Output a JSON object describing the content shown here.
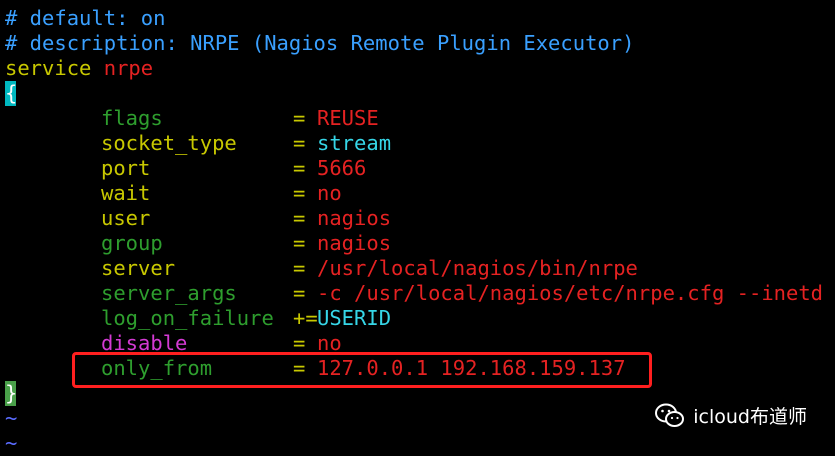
{
  "colors": {
    "comment": "#3aa0ff",
    "keyword": "#c8c800",
    "string": "#e52222",
    "operator": "#c8c800",
    "cyan": "#36d6e7",
    "green_dim": "#2e9e2e",
    "magenta": "#d43ad4",
    "brace_cursor": "#00b8c0",
    "highlight_box": "#ff1f1f"
  },
  "header": {
    "comment1": "# default: on",
    "comment2_prefix": "# description: ",
    "comment2_text": "NRPE (Nagios Remote Plugin Executor)",
    "service_keyword": "service",
    "service_name": "nrpe",
    "open_brace": "{",
    "close_brace": "}"
  },
  "config": [
    {
      "key": "flags",
      "op": "=",
      "value": "REUSE",
      "key_color": "#2e9e2e",
      "value_color": "#e52222"
    },
    {
      "key": "socket_type",
      "op": "=",
      "value": "stream",
      "key_color": "#c8c800",
      "value_color": "#36d6e7"
    },
    {
      "key": "port",
      "op": "=",
      "value": "5666",
      "key_color": "#c8c800",
      "value_color": "#e52222"
    },
    {
      "key": "wait",
      "op": "=",
      "value": "no",
      "key_color": "#c8c800",
      "value_color": "#e52222"
    },
    {
      "key": "user",
      "op": "=",
      "value": "nagios",
      "key_color": "#c8c800",
      "value_color": "#e52222"
    },
    {
      "key": "group",
      "op": "=",
      "value": "nagios",
      "key_color": "#2e9e2e",
      "value_color": "#e52222"
    },
    {
      "key": "server",
      "op": "=",
      "value": "/usr/local/nagios/bin/nrpe",
      "key_color": "#c8c800",
      "value_color": "#e52222"
    },
    {
      "key": "server_args",
      "op": "=",
      "value": "-c /usr/local/nagios/etc/nrpe.cfg --inetd",
      "key_color": "#2e9e2e",
      "value_color": "#e52222"
    },
    {
      "key": "log_on_failure",
      "op": "+=",
      "value": "USERID",
      "key_color": "#2e9e2e",
      "value_color": "#36d6e7"
    },
    {
      "key": "disable",
      "op": "=",
      "value": "no",
      "key_color": "#d43ad4",
      "value_color": "#e52222"
    },
    {
      "key": "only_from",
      "op": "=",
      "value": "127.0.0.1 192.168.159.137",
      "key_color": "#2e9e2e",
      "value_color": "#e52222"
    }
  ],
  "tildes": [
    "~",
    "~"
  ],
  "watermark": {
    "icon": "wechat-icon",
    "text": "icloud布道师"
  }
}
